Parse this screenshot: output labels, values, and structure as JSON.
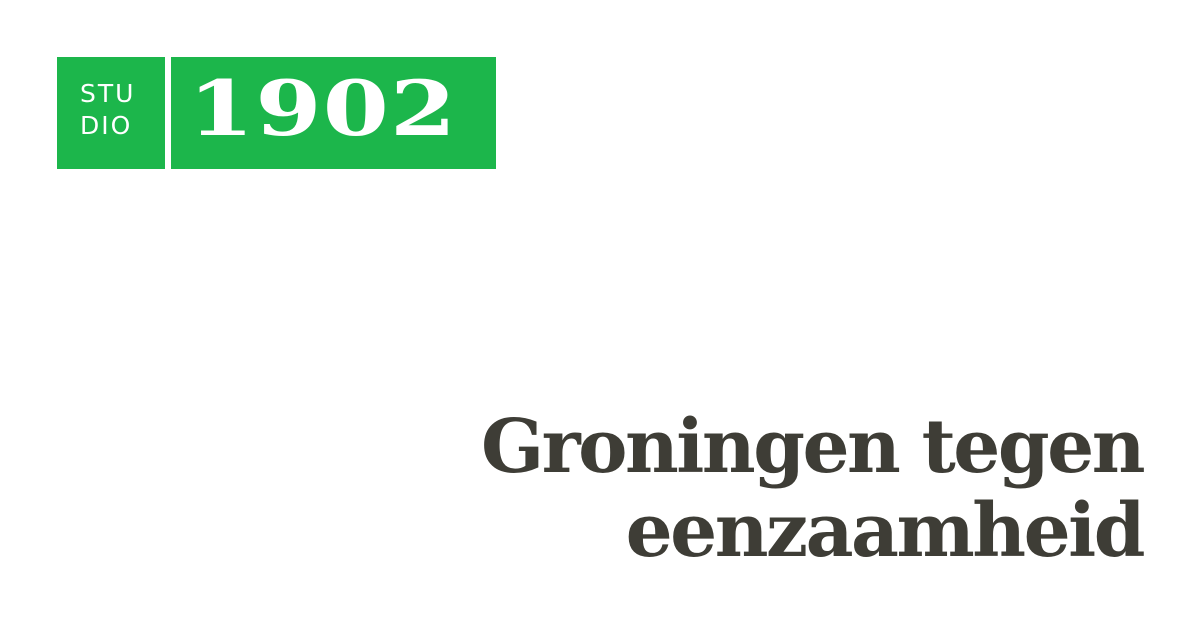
{
  "logo": {
    "studio_line1": "STU",
    "studio_line2": "DIO",
    "year": "1902",
    "color": "#1cb64b"
  },
  "headline": {
    "line1": "Groningen tegen",
    "line2": "eenzaamheid",
    "color": "#3e3d36"
  }
}
